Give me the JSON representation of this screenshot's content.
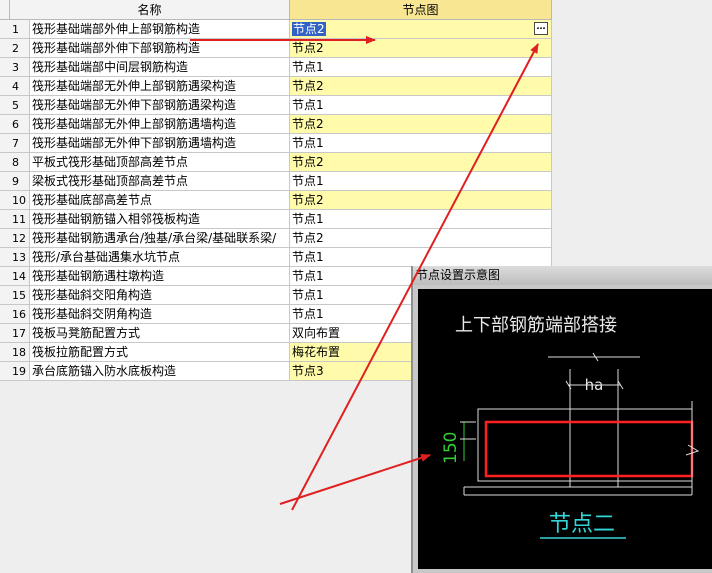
{
  "table": {
    "headers": {
      "name": "名称",
      "node": "节点图"
    },
    "rows": [
      {
        "num": "1",
        "name": "筏形基础端部外伸上部钢筋构造",
        "node": "节点2",
        "hl": false,
        "selected": true
      },
      {
        "num": "2",
        "name": "筏形基础端部外伸下部钢筋构造",
        "node": "节点2",
        "hl": true,
        "selected": false
      },
      {
        "num": "3",
        "name": "筏形基础端部中间层钢筋构造",
        "node": "节点1",
        "hl": false,
        "selected": false
      },
      {
        "num": "4",
        "name": "筏形基础端部无外伸上部钢筋遇梁构造",
        "node": "节点2",
        "hl": true,
        "selected": false
      },
      {
        "num": "5",
        "name": "筏形基础端部无外伸下部钢筋遇梁构造",
        "node": "节点1",
        "hl": false,
        "selected": false
      },
      {
        "num": "6",
        "name": "筏形基础端部无外伸上部钢筋遇墙构造",
        "node": "节点2",
        "hl": true,
        "selected": false
      },
      {
        "num": "7",
        "name": "筏形基础端部无外伸下部钢筋遇墙构造",
        "node": "节点1",
        "hl": false,
        "selected": false
      },
      {
        "num": "8",
        "name": "平板式筏形基础顶部高差节点",
        "node": "节点2",
        "hl": true,
        "selected": false
      },
      {
        "num": "9",
        "name": "梁板式筏形基础顶部高差节点",
        "node": "节点1",
        "hl": false,
        "selected": false
      },
      {
        "num": "10",
        "name": "筏形基础底部高差节点",
        "node": "节点2",
        "hl": true,
        "selected": false
      },
      {
        "num": "11",
        "name": "筏形基础钢筋锚入相邻筏板构造",
        "node": "节点1",
        "hl": false,
        "selected": false
      },
      {
        "num": "12",
        "name": "筏形基础钢筋遇承台/独基/承台梁/基础联系梁/",
        "node": "节点2",
        "hl": false,
        "selected": false
      },
      {
        "num": "13",
        "name": "筏形/承台基础遇集水坑节点",
        "node": "节点1",
        "hl": false,
        "selected": false
      },
      {
        "num": "14",
        "name": "筏形基础钢筋遇柱墩构造",
        "node": "节点1",
        "hl": false,
        "selected": false
      },
      {
        "num": "15",
        "name": "筏形基础斜交阳角构造",
        "node": "节点1",
        "hl": false,
        "selected": false
      },
      {
        "num": "16",
        "name": "筏形基础斜交阴角构造",
        "node": "节点1",
        "hl": false,
        "selected": false
      },
      {
        "num": "17",
        "name": "筏板马凳筋配置方式",
        "node": "双向布置",
        "hl": false,
        "selected": false
      },
      {
        "num": "18",
        "name": "筏板拉筋配置方式",
        "node": "梅花布置",
        "hl": true,
        "selected": false
      },
      {
        "num": "19",
        "name": "承台底筋锚入防水底板构造",
        "node": "节点3",
        "hl": true,
        "selected": false
      }
    ],
    "ellipsis_label": "…"
  },
  "panel": {
    "title": "节点设置示意图",
    "drawing_title": "上下部钢筋端部搭接",
    "dim_ha": "ha",
    "dim_150": "150",
    "node_label": "节点二"
  },
  "colors": {
    "header_node": "#f8e693",
    "highlight_row": "#fffbaa",
    "selection": "#3163c5",
    "annotation_arrow": "#e02020",
    "cad_title": "#e8e8e8",
    "cad_green": "#33cc33",
    "cad_red": "#ff2020",
    "cad_cyan": "#33d6d6"
  }
}
